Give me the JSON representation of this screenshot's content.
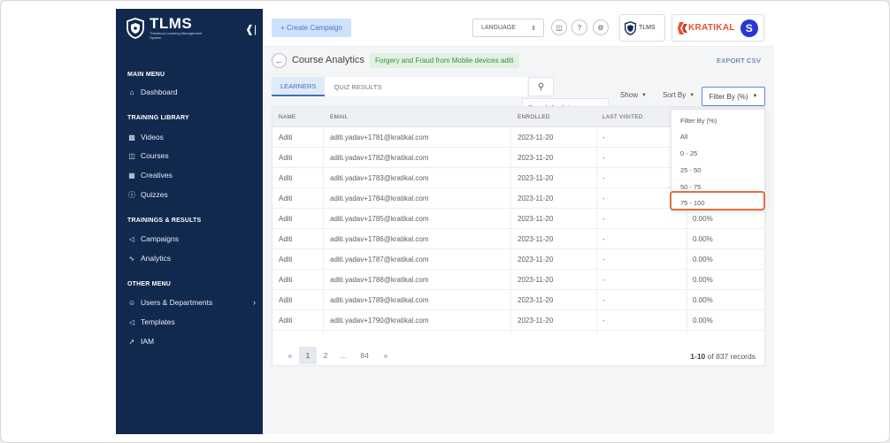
{
  "brand": {
    "title": "TLMS",
    "subtitle": "Threatcop Learning Management System"
  },
  "sidebar": {
    "sections": [
      {
        "label": "MAIN MENU",
        "items": [
          {
            "label": "Dashboard",
            "icon": "home-icon"
          }
        ]
      },
      {
        "label": "TRAINING LIBRARY",
        "items": [
          {
            "label": "Videos",
            "icon": "video-icon"
          },
          {
            "label": "Courses",
            "icon": "book-icon"
          },
          {
            "label": "Creatives",
            "icon": "image-icon"
          },
          {
            "label": "Quizzes",
            "icon": "question-icon"
          }
        ]
      },
      {
        "label": "TRAININGS & RESULTS",
        "items": [
          {
            "label": "Campaigns",
            "icon": "megaphone-icon"
          },
          {
            "label": "Analytics",
            "icon": "chart-line-icon"
          }
        ]
      },
      {
        "label": "OTHER MENU",
        "items": [
          {
            "label": "Users & Departments",
            "icon": "user-icon"
          },
          {
            "label": "Templates",
            "icon": "megaphone-icon"
          },
          {
            "label": "IAM",
            "icon": "key-icon"
          }
        ]
      }
    ]
  },
  "topbar": {
    "create_label": "+ Create Campaign",
    "language_label": "LANGUAGE",
    "tlms_card_label": "TLMS",
    "kratikal_label": "KRATIKAL",
    "avatar_letter": "S"
  },
  "page": {
    "title": "Course Analytics",
    "course_tag": "Forgery and Fraud from Mobile devices aditi",
    "export_label": "EXPORT CSV",
    "tabs": [
      {
        "label": "LEARNERS",
        "active": true
      },
      {
        "label": "QUIZ RESULTS",
        "active": false
      }
    ],
    "search_placeholder": "Search Analytics",
    "show_label": "Show",
    "sort_label": "Sort By",
    "filter_label": "Filter By (%)"
  },
  "filter_dropdown": {
    "items": [
      "Filter By (%)",
      "All",
      "0 - 25",
      "25 - 50",
      "50 - 75",
      "75 - 100"
    ],
    "highlighted": "75 - 100"
  },
  "table": {
    "columns": [
      "NAME",
      "EMAIL",
      "ENROLLED",
      "LAST VISITED"
    ],
    "rows": [
      {
        "name": "Aditi",
        "email": "aditi.yadav+1781@kratikal.com",
        "enrolled": "2023-11-20",
        "last_visited": "-",
        "progress": ""
      },
      {
        "name": "Aditi",
        "email": "aditi.yadav+1782@kratikal.com",
        "enrolled": "2023-11-20",
        "last_visited": "-",
        "progress": ""
      },
      {
        "name": "Aditi",
        "email": "aditi.yadav+1783@kratikal.com",
        "enrolled": "2023-11-20",
        "last_visited": "-",
        "progress": ""
      },
      {
        "name": "Aditi",
        "email": "aditi.yadav+1784@kratikal.com",
        "enrolled": "2023-11-20",
        "last_visited": "-",
        "progress": ""
      },
      {
        "name": "Aditi",
        "email": "aditi.yadav+1785@kratikal.com",
        "enrolled": "2023-11-20",
        "last_visited": "-",
        "progress": "0.00%"
      },
      {
        "name": "Aditi",
        "email": "aditi.yadav+1786@kratikal.com",
        "enrolled": "2023-11-20",
        "last_visited": "-",
        "progress": "0.00%"
      },
      {
        "name": "Aditi",
        "email": "aditi.yadav+1787@kratikal.com",
        "enrolled": "2023-11-20",
        "last_visited": "-",
        "progress": "0.00%"
      },
      {
        "name": "Aditi",
        "email": "aditi.yadav+1788@kratikal.com",
        "enrolled": "2023-11-20",
        "last_visited": "-",
        "progress": "0.00%"
      },
      {
        "name": "Aditi",
        "email": "aditi.yadav+1789@kratikal.com",
        "enrolled": "2023-11-20",
        "last_visited": "-",
        "progress": "0.00%"
      },
      {
        "name": "Aditi",
        "email": "aditi.yadav+1790@kratikal.com",
        "enrolled": "2023-11-20",
        "last_visited": "-",
        "progress": "0.00%"
      }
    ]
  },
  "pagination": {
    "prev": "«",
    "next": "»",
    "pages": [
      "1",
      "2",
      "...",
      "84"
    ],
    "current": "1",
    "range": "1-10",
    "of_label": "of 837 records"
  },
  "colors": {
    "sidebar": "#12294f",
    "accent": "#3c6fc4",
    "highlight": "#e07040",
    "tag_bg": "#e1f2e3",
    "tag_text": "#3d8b45"
  }
}
